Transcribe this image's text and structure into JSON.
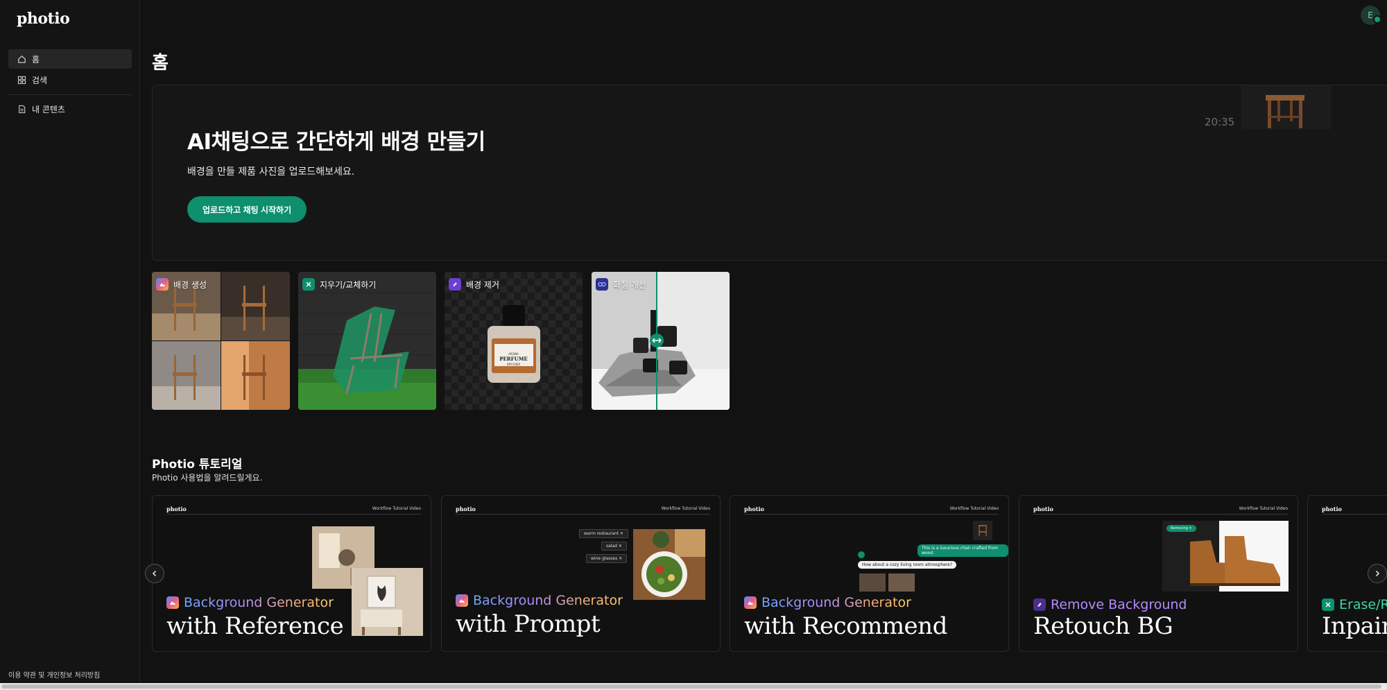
{
  "app": {
    "logo": "photio"
  },
  "sidebar": {
    "items": [
      {
        "label": "홈",
        "icon": "home-icon"
      },
      {
        "label": "검색",
        "icon": "grid-icon"
      },
      {
        "label": "내 콘텐츠",
        "icon": "document-icon"
      }
    ],
    "footer": "이용 약관 및 개인정보 처리방침"
  },
  "user": {
    "avatar_initial": "E"
  },
  "page": {
    "title": "홈"
  },
  "hero": {
    "title": "AI채팅으로 간단하게 배경 만들기",
    "subtitle": "배경을 만들 제품 사진을 업로드해보세요.",
    "button": "업로드하고 채팅 시작하기",
    "timestamp": "20:35"
  },
  "features": [
    {
      "label": "배경 생성",
      "badge_color": "#e85a8a"
    },
    {
      "label": "지우기/교체하기",
      "badge_color": "#0e8f6e"
    },
    {
      "label": "배경 제거",
      "badge_color": "#6b3fd1"
    },
    {
      "label": "화질 개선",
      "badge_color": "#3a3ad1"
    }
  ],
  "perfume": {
    "brand": "AROMA",
    "name": "PERFUME",
    "type": "DIFFUSER"
  },
  "tutorials": {
    "title": "Photio 튜토리얼",
    "subtitle": "Photio 사용법을 알려드릴게요.",
    "card_logo": "photio",
    "card_tag": "Workflow Tutorial Video",
    "cards": [
      {
        "category": "Background Generator",
        "headline": "with Reference"
      },
      {
        "category": "Background Generator",
        "headline": "with Prompt",
        "chips": [
          "warm restaurant",
          "salad",
          "wine glasses"
        ]
      },
      {
        "category": "Background Generator",
        "headline": "with Recommend",
        "chat_reply": "This is a luxurious chair crafted from wood.",
        "chat_question": "How about a cozy living room atmosphere?"
      },
      {
        "category": "Remove Background",
        "headline": "Retouch BG",
        "chip": "Removing"
      },
      {
        "category": "Erase/Re",
        "headline": "Inpain"
      }
    ]
  },
  "colors": {
    "accent": "#0e8f6e",
    "background": "#121212"
  }
}
